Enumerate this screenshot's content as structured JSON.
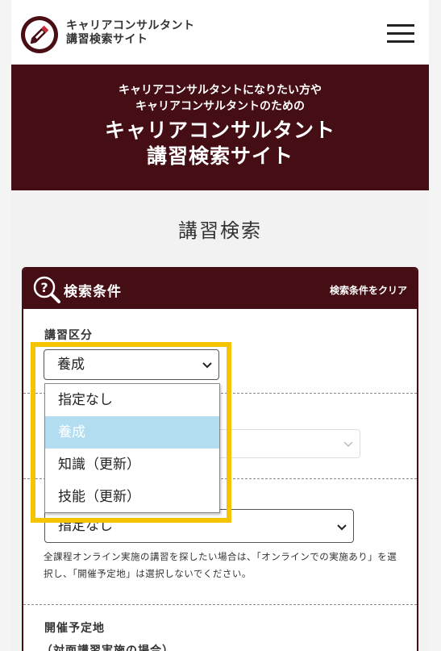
{
  "header": {
    "site_name_line1": "キャリアコンサルタント",
    "site_name_line2": "講習検索サイト",
    "logo_icon": "pencil-logo-icon",
    "menu_icon": "hamburger-menu-icon"
  },
  "hero": {
    "sub_line1": "キャリアコンサルタントになりたい方や",
    "sub_line2": "キャリアコンサルタントのための",
    "title_line1": "キャリアコンサルタント",
    "title_line2": "講習検索サイト"
  },
  "page_title": "講習検索",
  "search_panel": {
    "title": "検索条件",
    "icon": "search-help-icon",
    "clear_label": "検索条件をクリア",
    "course_type": {
      "label": "講習区分",
      "selected": "養成",
      "options": [
        "指定なし",
        "養成",
        "知識（更新）",
        "技能（更新）"
      ]
    },
    "second_select_value": "",
    "online": {
      "selected": "指定なし",
      "note": "全課程オンライン実施の講習を探したい場合は、「オンラインでの実施あり」を選択し、「開催予定地」は選択しないでください。"
    },
    "venue": {
      "label": "開催予定地",
      "sublabel": "（対面講習実施の場合）"
    }
  },
  "colors": {
    "brand": "#450d14",
    "highlight": "#f5c400",
    "option_selected": "#b2ddf0"
  }
}
